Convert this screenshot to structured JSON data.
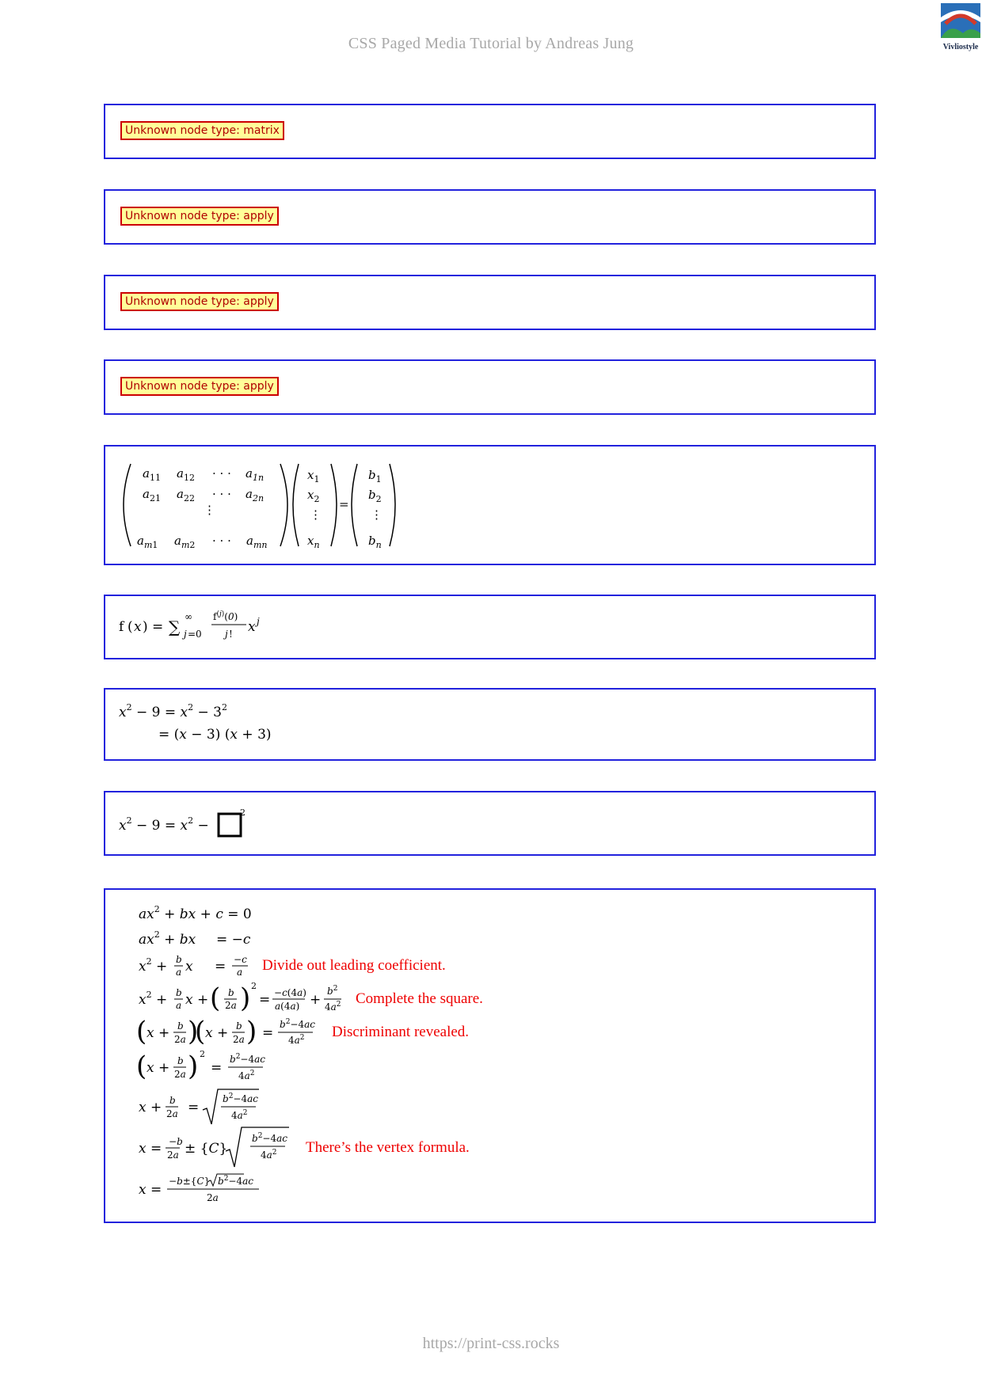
{
  "header": {
    "title": "CSS Paged Media Tutorial by Andreas Jung"
  },
  "footer": {
    "url": "https://print-css.rocks"
  },
  "logo": {
    "text": "Vivliostyle"
  },
  "errors": [
    "Unknown node type: matrix",
    "Unknown node type: apply",
    "Unknown node type: apply",
    "Unknown node type: apply"
  ],
  "annotations": {
    "step3": "Divide out leading coefficient.",
    "step4": "Complete the square.",
    "step5": "Discriminant revealed.",
    "step8": "There’s the vertex formula."
  },
  "colors": {
    "border": "#2222dd",
    "error_bg": "#ffff99",
    "error_border": "#cc0000",
    "annotation": "#ee0000",
    "header": "#a8a8a8"
  }
}
